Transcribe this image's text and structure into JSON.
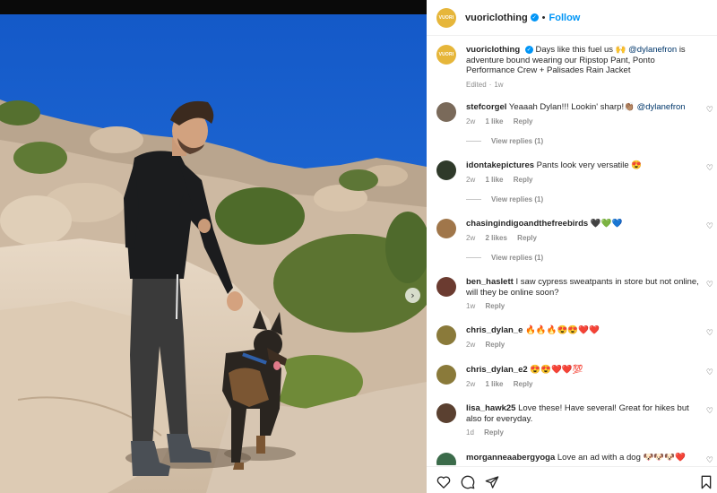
{
  "post": {
    "username": "vuoriclothing",
    "follow_label": "Follow",
    "logo_text": "VUORI"
  },
  "caption": {
    "username": "vuoriclothing",
    "text_before": "Days like this fuel us 🙌",
    "mention": "@dylanefron",
    "text_after": "is adventure bound wearing our Ripstop Pant, Ponto Performance Crew + Palisades Rain Jacket",
    "edited": "Edited",
    "age": "1w"
  },
  "comments": [
    {
      "username": "stefcorgel",
      "text": "Yeaaah Dylan!!! Lookin' sharp!👏🏽",
      "mention": "@dylanefron",
      "age": "2w",
      "likes": "1 like",
      "reply": "Reply",
      "view_replies": "View replies (1)",
      "avatar_color": "#7a6a5a"
    },
    {
      "username": "idontakepictures",
      "text": "Pants look very versatile 😍",
      "age": "2w",
      "likes": "1 like",
      "reply": "Reply",
      "view_replies": "View replies (1)",
      "avatar_color": "#2f3a2a"
    },
    {
      "username": "chasingindigoandthefreebirds",
      "text": "🖤💚💙",
      "age": "2w",
      "likes": "2 likes",
      "reply": "Reply",
      "view_replies": "View replies (1)",
      "avatar_color": "#a0764a"
    },
    {
      "username": "ben_haslett",
      "text": "I saw cypress sweatpants in store but not online, will they be online soon?",
      "age": "1w",
      "reply": "Reply",
      "avatar_color": "#6b3b30"
    },
    {
      "username": "chris_dylan_e",
      "text": "🔥🔥🔥😍😍❤️❤️",
      "age": "2w",
      "reply": "Reply",
      "avatar_color": "#8a7a3a"
    },
    {
      "username": "chris_dylan_e2",
      "text": "😍😍❤️❤️💯",
      "age": "2w",
      "likes": "1 like",
      "reply": "Reply",
      "avatar_color": "#8a7a3a"
    },
    {
      "username": "lisa_hawk25",
      "text": "Love these! Have several! Great for hikes but also for everyday.",
      "age": "1d",
      "reply": "Reply",
      "avatar_color": "#5a4030"
    },
    {
      "username": "morganneaabergyoga",
      "text": "Love an ad with a dog 🐶🐶🐶❤️",
      "avatar_color": "#3b6b4a"
    }
  ],
  "footer": {
    "icons": [
      "heart-outline-icon",
      "comment-icon",
      "share-icon",
      "bookmark-icon"
    ]
  },
  "colors": {
    "accent": "#0095f6",
    "verified": "#0095f6",
    "muted": "#8e8e8e",
    "logo_bg": "#e6b63a",
    "sky": "#1863cf"
  }
}
